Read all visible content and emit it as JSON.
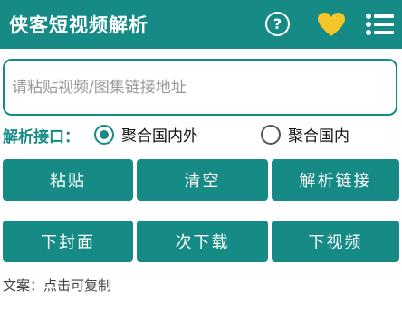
{
  "app": {
    "title": "侠客短视频解析",
    "help_symbol": "?"
  },
  "colors": {
    "primary": "#168b86",
    "heart": "#f5c62a"
  },
  "icons": {
    "help": "help-icon",
    "favorite": "heart-icon",
    "menu": "menu-icon"
  },
  "input": {
    "placeholder": "请粘贴视频/图集链接地址",
    "value": ""
  },
  "interface": {
    "label": "解析接口：",
    "options": [
      {
        "label": "聚合国内外",
        "selected": true
      },
      {
        "label": "聚合国内",
        "selected": false
      }
    ]
  },
  "buttons": {
    "paste": "粘贴",
    "clear": "清空",
    "parse": "解析链接",
    "download_cover": "下封面",
    "download_next": "次下载",
    "download_video": "下视频"
  },
  "footer": {
    "copy_hint": "文案：点击可复制"
  }
}
